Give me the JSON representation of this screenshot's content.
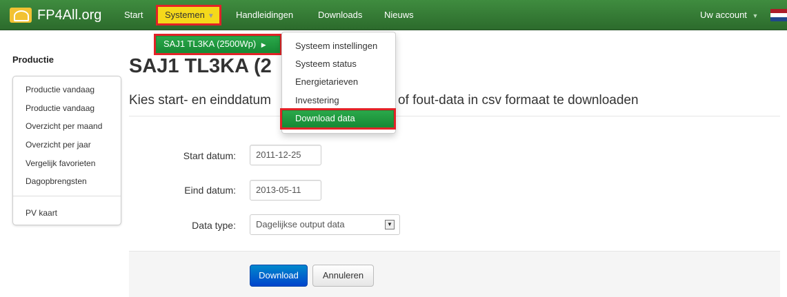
{
  "navbar": {
    "brand": "FP4All.org",
    "items": [
      "Start",
      "Systemen",
      "Handleidingen",
      "Downloads",
      "Nieuws"
    ],
    "account": "Uw account"
  },
  "systems_menu": {
    "system": "SAJ1 TL3KA (2500Wp)",
    "submenu": [
      "Systeem instellingen",
      "Systeem status",
      "Energietarieven",
      "Investering",
      "Download data"
    ]
  },
  "sidebar": {
    "title": "Productie",
    "items": [
      "Productie vandaag",
      "Productie vandaag",
      "Overzicht per maand",
      "Overzicht per jaar",
      "Vergelijk favorieten",
      "Dagopbrengsten"
    ],
    "extra_item": "PV kaart"
  },
  "main": {
    "title": "SAJ1 TL3KA (2",
    "subtitle_left": "Kies start- en einddatum",
    "subtitle_right": "of fout-data in csv formaat te downloaden",
    "form": {
      "start_label": "Start datum:",
      "start_value": "2011-12-25",
      "end_label": "Eind datum:",
      "end_value": "2013-05-11",
      "type_label": "Data type:",
      "type_value": "Dagelijkse output data"
    },
    "buttons": {
      "download": "Download",
      "cancel": "Annuleren"
    }
  },
  "colors": {
    "navbar": "#2f7a2f",
    "highlight": "#e32227",
    "selected_nav": "#f5d91b",
    "menu_active": "#1f8d36",
    "primary_button": "#0066cc"
  }
}
